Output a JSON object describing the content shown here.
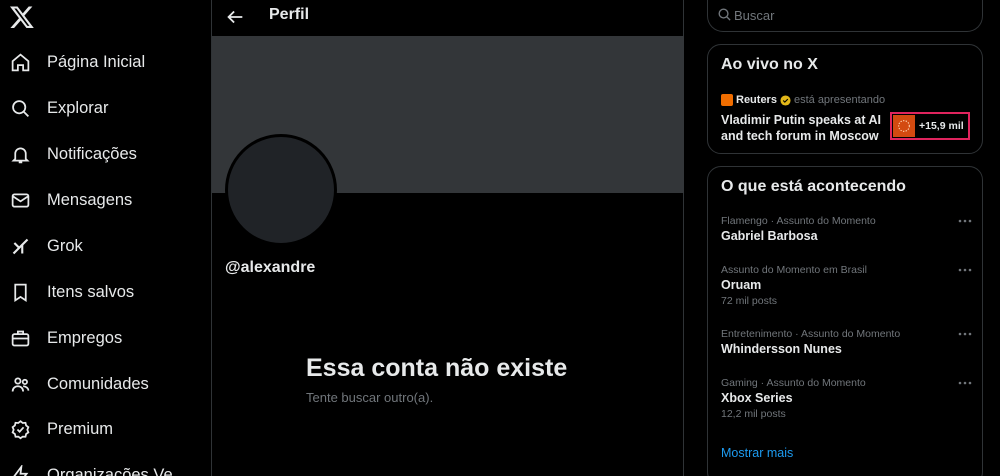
{
  "nav": {
    "items": [
      {
        "label": "Página Inicial",
        "icon": "home-icon"
      },
      {
        "label": "Explorar",
        "icon": "search-icon"
      },
      {
        "label": "Notificações",
        "icon": "bell-icon"
      },
      {
        "label": "Mensagens",
        "icon": "envelope-icon"
      },
      {
        "label": "Grok",
        "icon": "grok-icon"
      },
      {
        "label": "Itens salvos",
        "icon": "bookmark-icon"
      },
      {
        "label": "Empregos",
        "icon": "briefcase-icon"
      },
      {
        "label": "Comunidades",
        "icon": "people-icon"
      },
      {
        "label": "Premium",
        "icon": "premium-icon"
      },
      {
        "label": "Organizações Ve",
        "icon": "lightning-icon"
      }
    ]
  },
  "header": {
    "title": "Perfil"
  },
  "profile": {
    "handle": "@alexandre",
    "empty_title": "Essa conta não existe",
    "empty_subtitle": "Tente buscar outro(a)."
  },
  "search": {
    "placeholder": "Buscar"
  },
  "live": {
    "title": "Ao vivo no X",
    "source": "Reuters",
    "status": "está apresentando",
    "headline": "Vladimir Putin speaks at AI and tech forum in Moscow",
    "listeners": "+15,9 mil"
  },
  "trends": {
    "title": "O que está acontecendo",
    "items": [
      {
        "context": "Flamengo · Assunto do Momento",
        "name": "Gabriel Barbosa",
        "posts": ""
      },
      {
        "context": "Assunto do Momento em Brasil",
        "name": "Oruam",
        "posts": "72 mil posts"
      },
      {
        "context": "Entretenimento · Assunto do Momento",
        "name": "Whindersson Nunes",
        "posts": ""
      },
      {
        "context": "Gaming · Assunto do Momento",
        "name": "Xbox Series",
        "posts": "12,2 mil posts"
      }
    ],
    "show_more": "Mostrar mais"
  },
  "colors": {
    "background": "#000000",
    "text": "#e7e9ea",
    "muted": "#71767b",
    "border": "#2f3336",
    "banner": "#333639",
    "link": "#1d9bf0",
    "live_highlight": "#e0245e"
  }
}
